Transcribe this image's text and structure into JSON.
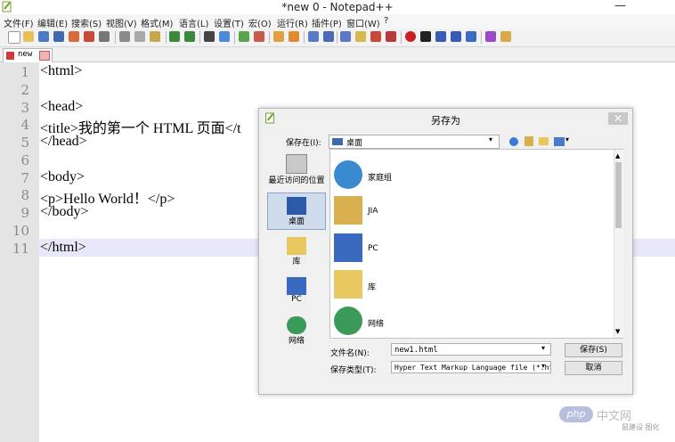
{
  "window": {
    "title": "*new  0 - Notepad++",
    "minimize": "—"
  },
  "menu": [
    "文件(F)",
    "编辑(E)",
    "搜索(S)",
    "视图(V)",
    "格式(M)",
    "语言(L)",
    "设置(T)",
    "宏(O)",
    "运行(R)",
    "插件(P)",
    "窗口(W)",
    "?"
  ],
  "tab": {
    "label": "new"
  },
  "editor": {
    "line_numbers": [
      "1",
      "2",
      "3",
      "4",
      "5",
      "6",
      "7",
      "8",
      "9",
      "10",
      "11"
    ],
    "lines": [
      "<html>",
      "",
      "<head>",
      "<title>我的第一个 HTML 页面</t",
      "</head>",
      "",
      "<body>",
      "<p>Hello World！</p>",
      "</body>",
      "",
      "</html>"
    ]
  },
  "dialog": {
    "title": "另存为",
    "close": "✕",
    "save_in_label": "保存在(I):",
    "save_in_value": "桌面",
    "places": [
      "最近访问的位置",
      "桌面",
      "库",
      "PC",
      "网络"
    ],
    "files": [
      "家庭组",
      "JIA",
      "PC",
      "库",
      "网络"
    ],
    "filename_label": "文件名(N):",
    "filename_value": "new1.html",
    "filetype_label": "保存类型(T):",
    "filetype_value": "Hyper Text Markup Language file (*.ht",
    "save_button": "保存(S)",
    "cancel_button": "取消"
  },
  "watermark": {
    "brand": "php",
    "site": "中文网",
    "caption": "鼠建设 图化"
  },
  "colors": {
    "accent": "#3b6fc4",
    "current_line": "#e8e8fa",
    "gutter": "#e4e4e4"
  }
}
